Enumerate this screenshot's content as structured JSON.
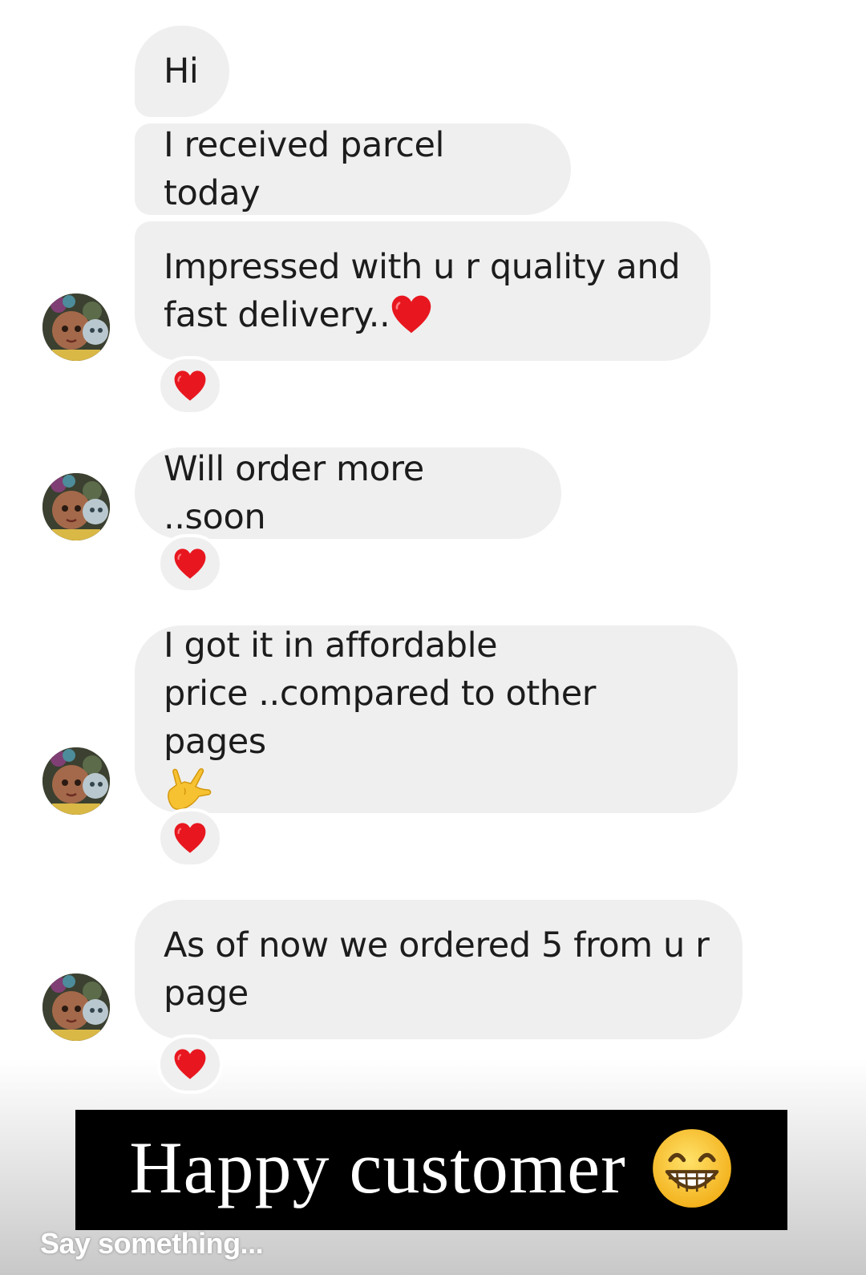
{
  "messages": [
    {
      "text": "Hi"
    },
    {
      "text": "I received parcel today"
    },
    {
      "text": "Impressed with u r quality and\nfast delivery.."
    },
    {
      "text": "Will order more ..soon"
    },
    {
      "text": "I got it in affordable\nprice ..compared to other pages"
    },
    {
      "text": "As of now we ordered 5 from u r\npage"
    }
  ],
  "reaction_icon": "red-heart-icon",
  "colors": {
    "bubble": "#efefef",
    "heart": "#e8171f",
    "caption_bg": "#000000",
    "caption_text": "#ffffff"
  },
  "caption": {
    "text": "Happy customer",
    "emoji_icon": "grinning-face-icon"
  },
  "input": {
    "placeholder": "Say something..."
  }
}
